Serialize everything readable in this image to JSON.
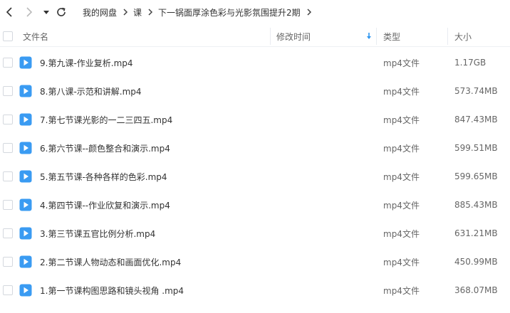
{
  "breadcrumb": {
    "items": [
      "我的网盘",
      "课",
      "下一锅面厚涂色彩与光影氛围提升2期"
    ]
  },
  "columns": {
    "name": "文件名",
    "modified": "修改时间",
    "type": "类型",
    "size": "大小"
  },
  "files": [
    {
      "name": "9.第九课-作业复析.mp4",
      "type": "mp4文件",
      "size": "1.17GB"
    },
    {
      "name": "8.第八课-示范和讲解.mp4",
      "type": "mp4文件",
      "size": "573.74MB"
    },
    {
      "name": "7.第七节课光影的一二三四五.mp4",
      "type": "mp4文件",
      "size": "847.43MB"
    },
    {
      "name": "6.第六节课--颜色整合和演示.mp4",
      "type": "mp4文件",
      "size": "599.51MB"
    },
    {
      "name": "5.第五节课-各种各样的色彩.mp4",
      "type": "mp4文件",
      "size": "599.65MB"
    },
    {
      "name": "4.第四节课--作业欣复和演示.mp4",
      "type": "mp4文件",
      "size": "885.43MB"
    },
    {
      "name": "3.第三节课五官比例分析.mp4",
      "type": "mp4文件",
      "size": "631.21MB"
    },
    {
      "name": "2.第二节课人物动态和画面优化.mp4",
      "type": "mp4文件",
      "size": "450.99MB"
    },
    {
      "name": "1.第一节课构图思路和镜头视角 .mp4",
      "type": "mp4文件",
      "size": "368.07MB"
    }
  ],
  "colors": {
    "accent": "#2f96f0",
    "icon_blue": "#3a9bf2"
  }
}
